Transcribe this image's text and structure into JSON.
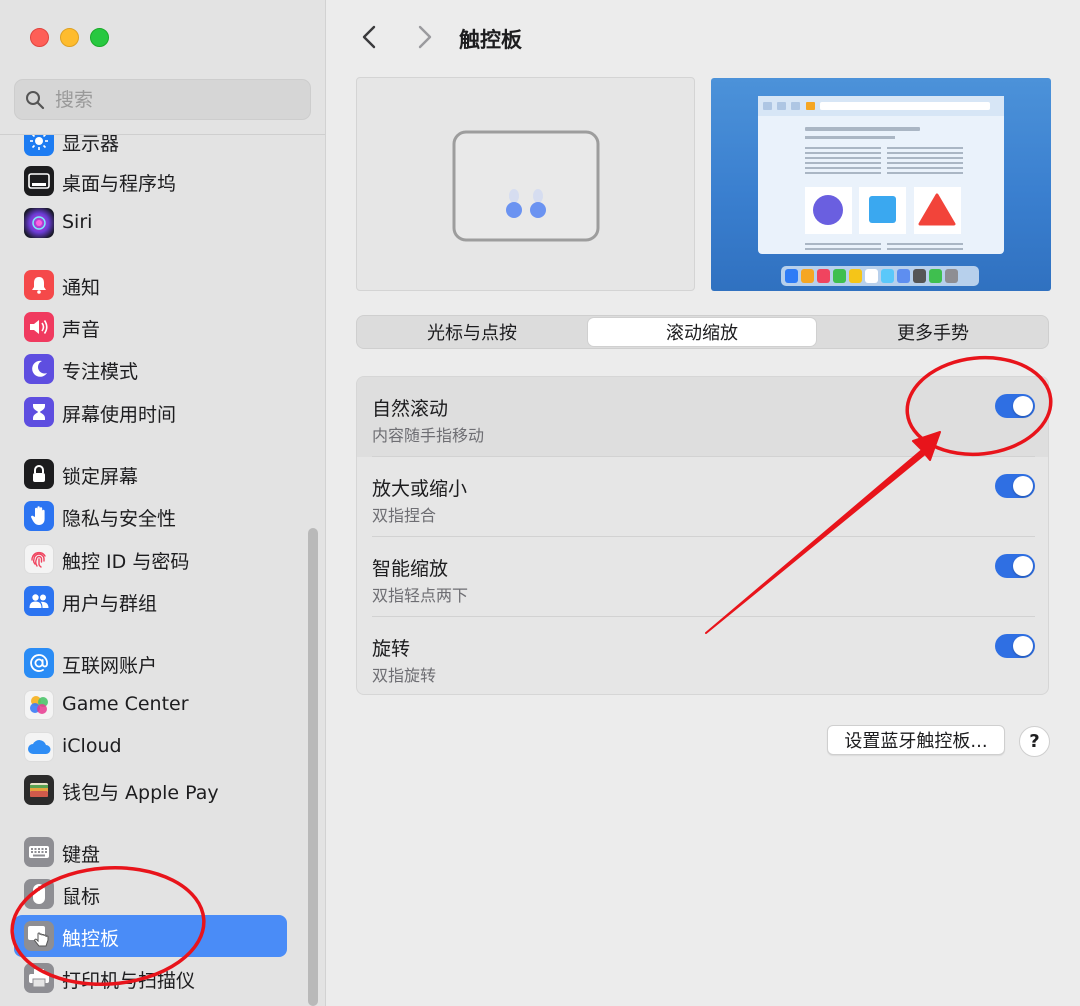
{
  "window": {
    "title": "触控板"
  },
  "search": {
    "placeholder": "搜索"
  },
  "sidebar": {
    "items": [
      {
        "label": "显示器",
        "icon": "display-icon",
        "color": "#1d7cf2"
      },
      {
        "label": "桌面与程序坞",
        "icon": "dock-icon",
        "color": "#1c1c1e"
      },
      {
        "label": "Siri",
        "icon": "siri-icon",
        "color": "#2a2a40"
      },
      {
        "label": "通知",
        "icon": "bell-icon",
        "color": "#f5494a"
      },
      {
        "label": "声音",
        "icon": "speaker-icon",
        "color": "#f03a5f"
      },
      {
        "label": "专注模式",
        "icon": "moon-icon",
        "color": "#5e4ee0"
      },
      {
        "label": "屏幕使用时间",
        "icon": "hourglass-icon",
        "color": "#5e4ee0"
      },
      {
        "label": "锁定屏幕",
        "icon": "lock-icon",
        "color": "#1c1c1e"
      },
      {
        "label": "隐私与安全性",
        "icon": "hand-icon",
        "color": "#2c74f1"
      },
      {
        "label": "触控 ID 与密码",
        "icon": "fingerprint-icon",
        "color": "#f4f4f4"
      },
      {
        "label": "用户与群组",
        "icon": "users-icon",
        "color": "#2c74f1"
      },
      {
        "label": "互联网账户",
        "icon": "at-icon",
        "color": "#2a8cf5"
      },
      {
        "label": "Game Center",
        "icon": "game-center-icon",
        "color": "#f4f4f4"
      },
      {
        "label": "iCloud",
        "icon": "cloud-icon",
        "color": "#f4f4f4"
      },
      {
        "label": "钱包与 Apple Pay",
        "icon": "wallet-icon",
        "color": "#2b2b2b"
      },
      {
        "label": "键盘",
        "icon": "keyboard-icon",
        "color": "#8e8e93"
      },
      {
        "label": "鼠标",
        "icon": "mouse-icon",
        "color": "#8e8e93"
      },
      {
        "label": "触控板",
        "icon": "trackpad-icon",
        "color": "#8e8e93",
        "selected": true
      },
      {
        "label": "打印机与扫描仪",
        "icon": "printer-icon",
        "color": "#8e8e93"
      }
    ]
  },
  "tabs": [
    {
      "label": "光标与点按"
    },
    {
      "label": "滚动缩放",
      "active": true
    },
    {
      "label": "更多手势"
    }
  ],
  "settings": [
    {
      "title": "自然滚动",
      "subtitle": "内容随手指移动",
      "enabled": true
    },
    {
      "title": "放大或缩小",
      "subtitle": "双指捏合",
      "enabled": true
    },
    {
      "title": "智能缩放",
      "subtitle": "双指轻点两下",
      "enabled": true
    },
    {
      "title": "旋转",
      "subtitle": "双指旋转",
      "enabled": true
    }
  ],
  "buttons": {
    "setup_bluetooth": "设置蓝牙触控板...",
    "help": "?"
  },
  "colors": {
    "accent": "#2f6fe3",
    "selection": "#4a8cf7",
    "annotation": "#e8141b"
  }
}
